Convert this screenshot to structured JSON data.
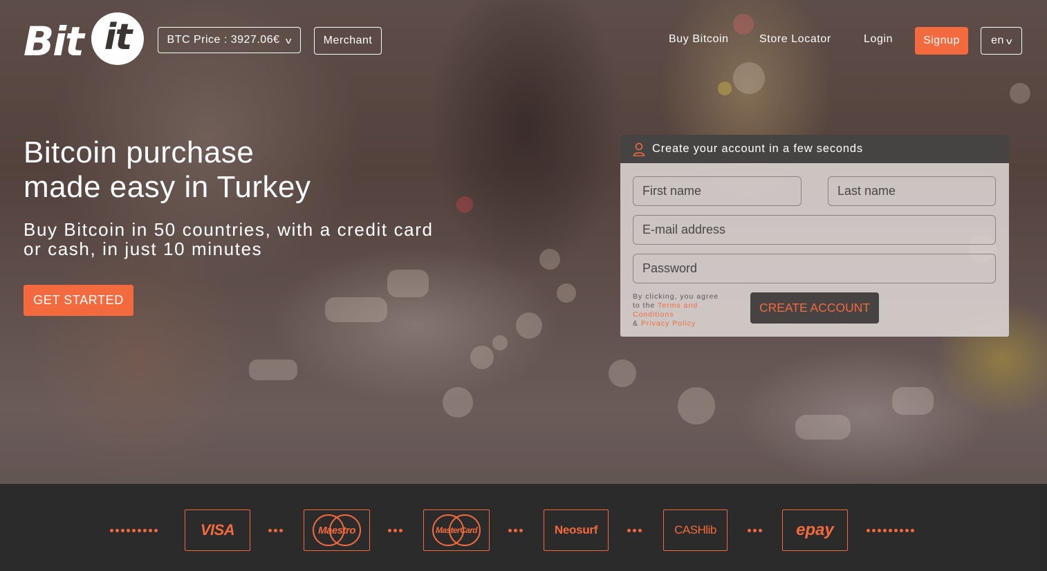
{
  "header": {
    "logo_text_a": "Bit",
    "logo_text_b": "it",
    "btc_price_label": "BTC Price : 3927.06€",
    "merchant_label": "Merchant",
    "nav": {
      "buy_bitcoin": "Buy Bitcoin",
      "store_locator": "Store Locator",
      "login": "Login",
      "signup": "Signup"
    },
    "language": "en"
  },
  "hero": {
    "headline_line1": "Bitcoin purchase",
    "headline_line2": "made easy in Turkey",
    "subline_line1": "Buy Bitcoin in 50 countries, with a credit card",
    "subline_line2": "or cash, in just 10 minutes",
    "cta_label": "GET STARTED"
  },
  "signup_card": {
    "title": "Create your account in a few seconds",
    "first_name_placeholder": "First name",
    "last_name_placeholder": "Last name",
    "email_placeholder": "E-mail address",
    "password_placeholder": "Password",
    "terms_prefix": "By clicking, you agree to the",
    "terms_link": "Terms and Conditions",
    "terms_amp": "&",
    "privacy_link": "Privacy Policy",
    "create_label": "CREATE ACCOUNT"
  },
  "payments": {
    "visa": "VISA",
    "maestro": "Maestro",
    "mastercard": "MasterCard",
    "neosurf": "Neosurf",
    "cashlib": "CASHlib",
    "epay": "epay"
  },
  "colors": {
    "accent": "#f26a3d",
    "dark": "#2b2b2b",
    "card_header": "#464343"
  },
  "icons": {
    "user": "user-icon",
    "chevron": "chevron-down-icon"
  }
}
